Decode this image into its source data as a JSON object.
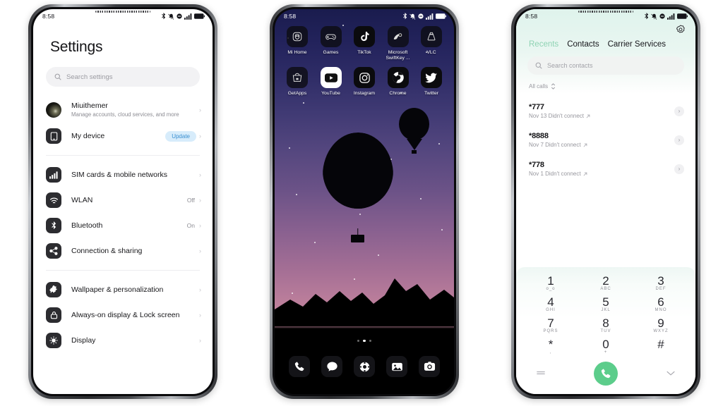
{
  "status_bar": {
    "time": "8:58",
    "icons": [
      "bluetooth-icon",
      "vibrate-icon",
      "do-not-disturb-icon",
      "signal-icon",
      "battery-icon"
    ]
  },
  "settings_phone": {
    "title": "Settings",
    "search": {
      "placeholder": "Search settings",
      "icon": "search-icon"
    },
    "items": [
      {
        "icon": "account-avatar",
        "label": "Miuithemer",
        "sub": "Manage accounts, cloud services, and more",
        "value": "",
        "badge": ""
      },
      {
        "icon": "device-icon",
        "label": "My device",
        "sub": "",
        "value": "",
        "badge": "Update"
      },
      {
        "icon": "sim-signal-icon",
        "label": "SIM cards & mobile networks",
        "sub": "",
        "value": "",
        "badge": ""
      },
      {
        "icon": "wlan-icon",
        "label": "WLAN",
        "sub": "",
        "value": "Off",
        "badge": ""
      },
      {
        "icon": "bluetooth-icon",
        "label": "Bluetooth",
        "sub": "",
        "value": "On",
        "badge": ""
      },
      {
        "icon": "share-icon",
        "label": "Connection & sharing",
        "sub": "",
        "value": "",
        "badge": ""
      },
      {
        "icon": "puzzle-icon",
        "label": "Wallpaper & personalization",
        "sub": "",
        "value": "",
        "badge": ""
      },
      {
        "icon": "lock-icon",
        "label": "Always-on display & Lock screen",
        "sub": "",
        "value": "",
        "badge": ""
      },
      {
        "icon": "display-icon",
        "label": "Display",
        "sub": "",
        "value": "",
        "badge": ""
      }
    ]
  },
  "home_phone": {
    "wallpaper": "hot-air-balloons-at-dusk-silhouette",
    "app_rows": [
      [
        {
          "label": "Mi Home",
          "icon": "mi-home-icon"
        },
        {
          "label": "Games",
          "icon": "gamepad-icon"
        },
        {
          "label": "TikTok",
          "icon": "tiktok-icon"
        },
        {
          "label": "Microsoft SwiftKey ...",
          "icon": "swiftkey-icon"
        },
        {
          "label": "VLC",
          "icon": "vlc-cone-icon"
        }
      ],
      [
        {
          "label": "GetApps",
          "icon": "getapps-icon"
        },
        {
          "label": "YouTube",
          "icon": "youtube-icon"
        },
        {
          "label": "Instagram",
          "icon": "instagram-icon"
        },
        {
          "label": "Chrome",
          "icon": "chrome-icon"
        },
        {
          "label": "Twitter",
          "icon": "twitter-bird-icon"
        }
      ]
    ],
    "page_dots": {
      "count": 3,
      "active_index": 1
    },
    "dock": [
      {
        "icon": "phone-icon",
        "label": "Phone"
      },
      {
        "icon": "messages-icon",
        "label": "Messages"
      },
      {
        "icon": "browser-icon",
        "label": "Browser"
      },
      {
        "icon": "gallery-icon",
        "label": "Gallery"
      },
      {
        "icon": "camera-icon",
        "label": "Camera"
      }
    ]
  },
  "dialer_phone": {
    "settings_icon": "gear-icon",
    "tabs": [
      {
        "label": "Recents",
        "active": true
      },
      {
        "label": "Contacts",
        "active": false
      },
      {
        "label": "Carrier Services",
        "active": false
      }
    ],
    "active_tab_color": "#8fd3b4",
    "search": {
      "placeholder": "Search contacts",
      "icon": "search-icon"
    },
    "filter": {
      "label": "All calls",
      "icon": "sort-icon"
    },
    "calls": [
      {
        "number": "*777",
        "detail": "Nov 13 Didn't connect",
        "direction_icon": "outgoing-call-icon"
      },
      {
        "number": "*8888",
        "detail": "Nov 7 Didn't connect",
        "direction_icon": "outgoing-call-icon"
      },
      {
        "number": "*778",
        "detail": "Nov 1 Didn't connect",
        "direction_icon": "outgoing-call-icon"
      }
    ],
    "keypad": [
      [
        {
          "n": "1",
          "l": "o_o"
        },
        {
          "n": "2",
          "l": "ABC"
        },
        {
          "n": "3",
          "l": "DEF"
        }
      ],
      [
        {
          "n": "4",
          "l": "GHI"
        },
        {
          "n": "5",
          "l": "JKL"
        },
        {
          "n": "6",
          "l": "MNO"
        }
      ],
      [
        {
          "n": "7",
          "l": "PQRS"
        },
        {
          "n": "8",
          "l": "TUV"
        },
        {
          "n": "9",
          "l": "WXYZ"
        }
      ],
      [
        {
          "n": "*",
          "l": ","
        },
        {
          "n": "0",
          "l": "+"
        },
        {
          "n": "#",
          "l": ""
        }
      ]
    ],
    "actions": {
      "left_icon": "keypad-menu-icon",
      "call_icon": "call-icon",
      "call_button_color": "#5ccd8b",
      "right_icon": "chevron-down-icon"
    }
  }
}
